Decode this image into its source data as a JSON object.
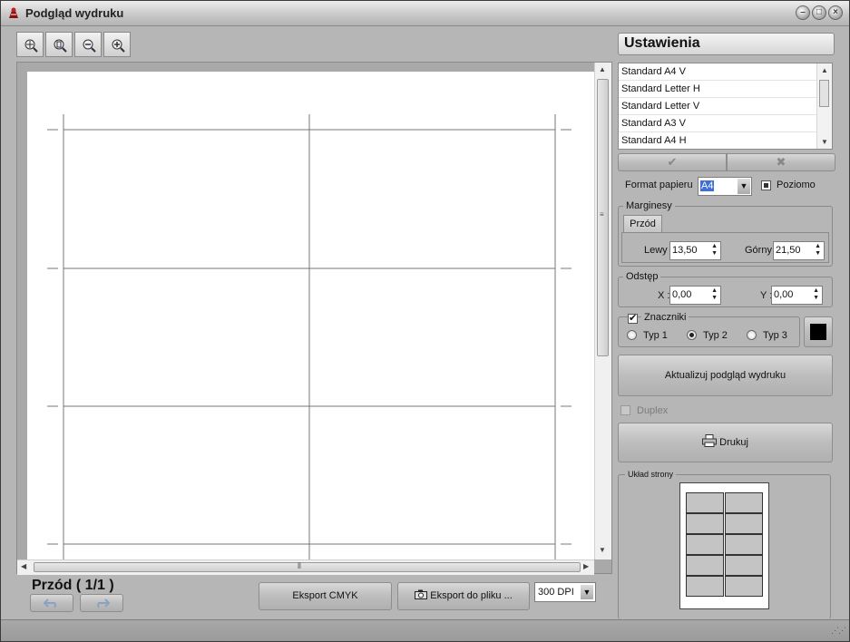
{
  "window": {
    "title": "Podgląd wydruku"
  },
  "toolbar": {
    "tools": [
      "zoom-fit-icon",
      "zoom-page-icon",
      "zoom-out-icon",
      "zoom-in-icon"
    ]
  },
  "footer": {
    "page_label": "Przód ( 1/1 )",
    "export_cmyk": "Eksport CMYK",
    "export_file": "Eksport do pliku ...",
    "dpi": "300 DPI"
  },
  "settings": {
    "title": "Ustawienia",
    "presets": [
      "Standard A4 V",
      "Standard Letter H",
      "Standard Letter V",
      "Standard A3 V",
      "Standard A4 H"
    ],
    "format_label": "Format papieru",
    "format_value": "A4",
    "landscape_label": "Poziomo",
    "margins": {
      "title": "Marginesy",
      "tab": "Przód",
      "left_label": "Lewy",
      "left_value": "13,50",
      "top_label": "Górny",
      "top_value": "21,50"
    },
    "spacing": {
      "title": "Odstęp",
      "x_label": "X :",
      "x_value": "0,00",
      "y_label": "Y :",
      "y_value": "0,00"
    },
    "marks": {
      "label": "Znaczniki",
      "checked": true,
      "types": [
        "Typ 1",
        "Typ 2",
        "Typ 3"
      ],
      "selected": 1,
      "color": "#000000"
    },
    "update_button": "Aktualizuj podgląd wydruku",
    "duplex_label": "Duplex",
    "print_button": "Drukuj",
    "layout_title": "Układ strony"
  }
}
